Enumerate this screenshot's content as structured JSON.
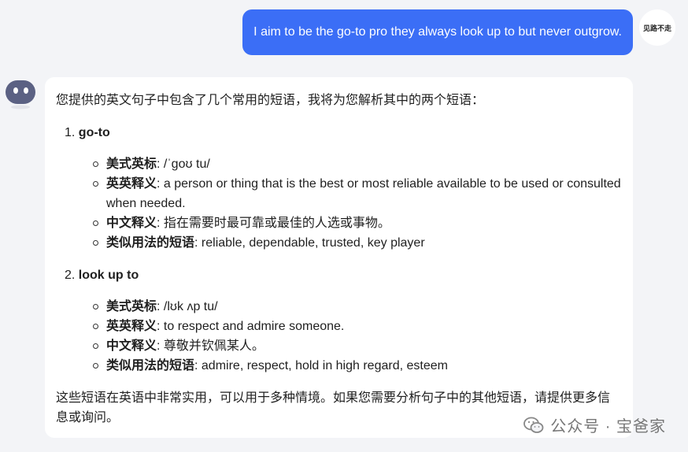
{
  "user": {
    "message": "I aim to be the go-to pro they always look up to but never outgrow.",
    "avatar_text": "见路不走"
  },
  "bot": {
    "intro": "您提供的英文句子中包含了几个常用的短语，我将为您解析其中的两个短语：",
    "terms": [
      {
        "number": "1.",
        "term": "go-to",
        "details": [
          {
            "label": "美式英标",
            "sep": ": ",
            "value": "/ˈɡoʊ tu/"
          },
          {
            "label": "英英释义",
            "sep": ": ",
            "value": "a person or thing that is the best or most reliable available to be used or consulted when needed."
          },
          {
            "label": "中文释义",
            "sep": ": ",
            "value": "指在需要时最可靠或最佳的人选或事物。"
          },
          {
            "label": "类似用法的短语",
            "sep": ": ",
            "value": "reliable, dependable, trusted, key player"
          }
        ]
      },
      {
        "number": "2.",
        "term": "look up to",
        "details": [
          {
            "label": "美式英标",
            "sep": ": ",
            "value": "/lʊk ʌp tu/"
          },
          {
            "label": "英英释义",
            "sep": ": ",
            "value": "to respect and admire someone."
          },
          {
            "label": "中文释义",
            "sep": ": ",
            "value": "尊敬并钦佩某人。"
          },
          {
            "label": "类似用法的短语",
            "sep": ": ",
            "value": "admire, respect, hold in high regard, esteem"
          }
        ]
      }
    ],
    "outro": "这些短语在英语中非常实用，可以用于多种情境。如果您需要分析句子中的其他短语，请提供更多信息或询问。"
  },
  "watermark": {
    "text": "公众号 · 宝爸家",
    "icon": "wechat-icon"
  },
  "colors": {
    "background": "#f3f4f7",
    "user_bubble": "#3b6ef6",
    "bot_avatar": "#5b6183"
  }
}
